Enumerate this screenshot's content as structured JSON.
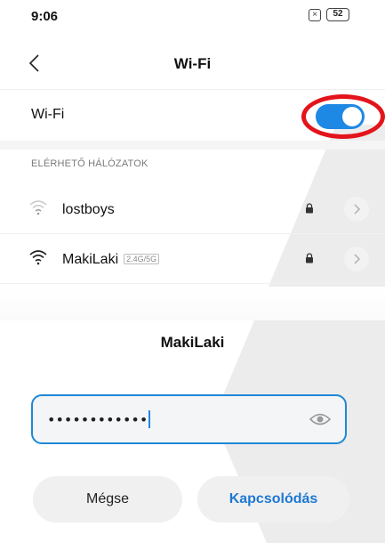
{
  "status_bar": {
    "time": "9:06",
    "sim_icon": "sim-off-icon",
    "sim_glyph": "×",
    "battery": "52"
  },
  "header": {
    "back_icon": "back-chevron-icon",
    "title": "Wi-Fi"
  },
  "wifi_toggle": {
    "label": "Wi-Fi",
    "state": "on",
    "accent": "#1e88e5",
    "highlight_color": "#e3141b"
  },
  "networks": {
    "section_label": "ELÉRHETŐ HÁLÓZATOK",
    "items": [
      {
        "name": "lostboys",
        "badge": "",
        "secured": true,
        "icon": "wifi-weak-icon"
      },
      {
        "name": "MakiLaki",
        "badge": "2.4G/5G",
        "secured": true,
        "icon": "wifi-full-icon"
      }
    ]
  },
  "dialog": {
    "title": "MakiLaki",
    "password_masked": "••••••••••••",
    "eye_icon": "eye-icon",
    "cancel_label": "Mégse",
    "connect_label": "Kapcsolódás",
    "connect_color": "#1e78d2"
  }
}
